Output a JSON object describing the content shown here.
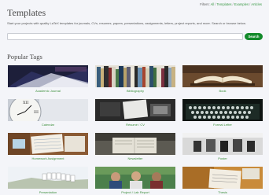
{
  "filters": {
    "prefix": "Filters:",
    "links": [
      "All",
      "Templates",
      "Examples",
      "Articles"
    ],
    "separator": "/"
  },
  "page": {
    "title": "Templates",
    "intro": "Start your projects with quality LaTeX templates for journals, CVs, resumes, papers, presentations, assignments, letters, project reports, and more. Search or browse below."
  },
  "search": {
    "value": "",
    "placeholder": "",
    "button_label": "Search"
  },
  "popular_tags": {
    "heading": "Popular Tags",
    "tags": [
      {
        "label": "Academic Journal",
        "image": "journal-image"
      },
      {
        "label": "Bibliography",
        "image": "bookshelf-image"
      },
      {
        "label": "Book",
        "image": "open-book-image"
      },
      {
        "label": "Calendar",
        "image": "clock-image"
      },
      {
        "label": "Résumé / CV",
        "image": "desk-image"
      },
      {
        "label": "Formal Letter",
        "image": "typewriter-image"
      },
      {
        "label": "Homework Assignment",
        "image": "notebook-image"
      },
      {
        "label": "Newsletter",
        "image": "reader-image"
      },
      {
        "label": "Poster",
        "image": "poster-image"
      },
      {
        "label": "Presentation",
        "image": "hollywood-image"
      },
      {
        "label": "Project / Lab Report",
        "image": "students-image"
      },
      {
        "label": "Thesis",
        "image": "writing-image"
      }
    ]
  },
  "colors": {
    "accent_green": "#138a2b",
    "link_green": "#3c8f3c",
    "background": "#f4f5f9"
  }
}
